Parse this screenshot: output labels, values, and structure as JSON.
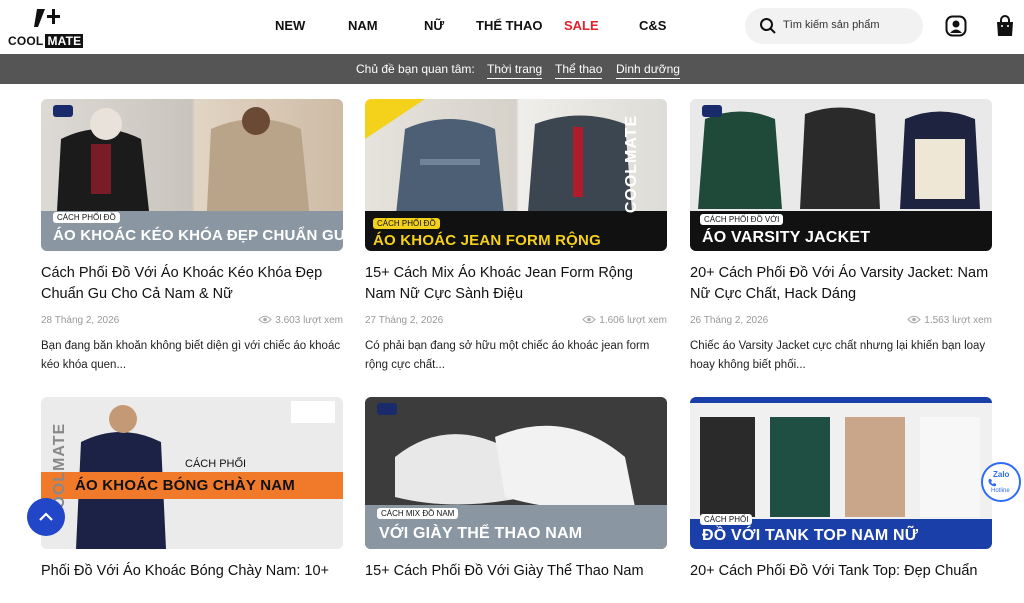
{
  "brand": {
    "top": "COOL",
    "bottom": "MATE"
  },
  "nav": [
    {
      "label": "NEW"
    },
    {
      "label": "NAM"
    },
    {
      "label": "NỮ"
    },
    {
      "label": "THỂ THAO"
    },
    {
      "label": "SALE"
    },
    {
      "label": "C&S"
    }
  ],
  "search": {
    "placeholder": "Tìm kiếm sản phẩm"
  },
  "topics": {
    "lead": "Chủ đề bạn quan tâm:",
    "items": [
      "Thời trang",
      "Thể thao",
      "Dinh dưỡng"
    ]
  },
  "articles": [
    {
      "tag": "CÁCH PHỐI ĐỒ",
      "banner": "ÁO KHOÁC KÉO KHÓA ĐẸP CHUẨN GU",
      "title": "Cách Phối Đồ Với Áo Khoác Kéo Khóa Đẹp Chuẩn Gu Cho Cả Nam & Nữ",
      "date": "28 Tháng 2, 2026",
      "views": "3.603 lượt xem",
      "excerpt": "Bạn đang băn khoăn không biết diện gì với chiếc áo khoác kéo khóa quen..."
    },
    {
      "tag": "CÁCH PHỐI ĐỒ",
      "banner": "ÁO KHOÁC JEAN FORM RỘNG",
      "side": "COOLMATE",
      "title": "15+ Cách Mix Áo Khoác Jean Form Rộng Nam Nữ Cực Sành Điệu",
      "date": "27 Tháng 2, 2026",
      "views": "1.606 lượt xem",
      "excerpt": "Có phải bạn đang sở hữu một chiếc áo khoác jean form rộng cực chất..."
    },
    {
      "tag": "CÁCH PHỐI ĐỒ VỚI",
      "banner": "ÁO VARSITY JACKET",
      "title": "20+ Cách Phối Đồ Với Áo Varsity Jacket: Nam Nữ Cực Chất, Hack Dáng",
      "date": "26 Tháng 2, 2026",
      "views": "1.563 lượt xem",
      "excerpt": "Chiếc áo Varsity Jacket cực chất nhưng lại khiến bạn loay hoay không biết phối..."
    },
    {
      "tag": "CÁCH PHỐI",
      "banner": "ÁO KHOÁC BÓNG CHÀY NAM",
      "side": "COOLMATE",
      "title": "Phối Đồ Với Áo Khoác Bóng Chày Nam: 10+"
    },
    {
      "tag": "CÁCH MIX ĐỒ NAM",
      "banner": "VỚI GIÀY THỂ THAO NAM",
      "title": "15+ Cách Phối Đồ Với Giày Thể Thao Nam"
    },
    {
      "tag": "CÁCH PHỐI",
      "banner": "ĐỒ VỚI TANK TOP NAM NỮ",
      "title": "20+ Cách Phối Đồ Với Tank Top: Đẹp Chuẩn"
    }
  ],
  "widgets": {
    "zalo": "Zalo",
    "hotline": "Hotline"
  },
  "colors": {
    "sale": "#e5202c",
    "topic_bar": "#555555",
    "accent": "#2146c7",
    "banner_gray": "#8a97a3",
    "banner_black": "#111111",
    "banner_orange": "#f07a2a",
    "banner_blue": "#1a3fa8"
  },
  "icons": [
    "search-icon",
    "user-icon",
    "cart-icon",
    "eye-icon",
    "arrow-up-icon",
    "phone-icon"
  ]
}
